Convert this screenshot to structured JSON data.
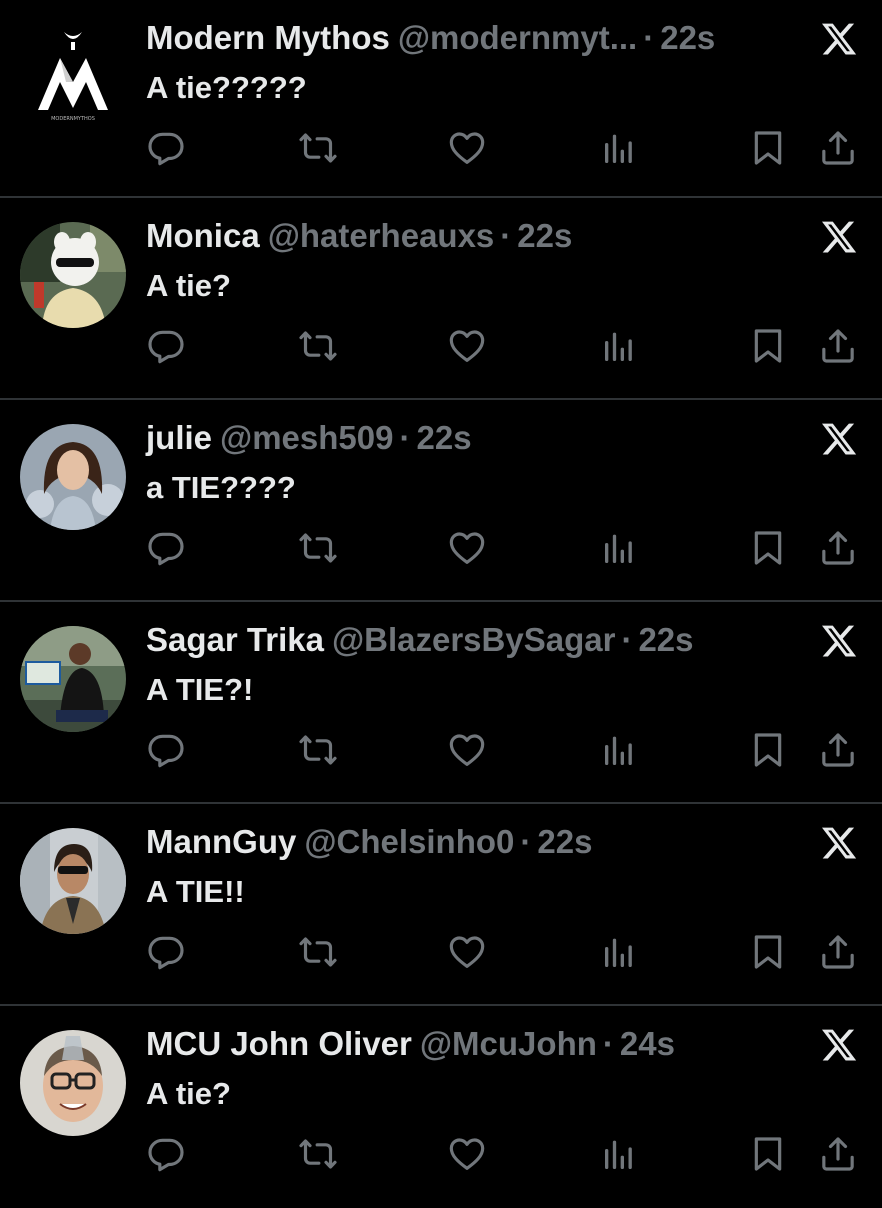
{
  "tweets": [
    {
      "name": "Modern Mythos",
      "handle": "@modernmyt...",
      "time": "22s",
      "text": "A tie?????",
      "avatar": "modern-mythos-logo",
      "avatar_text": "MODERNMYTHOS"
    },
    {
      "name": "Monica",
      "handle": "@haterheauxs",
      "time": "22s",
      "text": "A tie?",
      "avatar": "character-in-sunglasses"
    },
    {
      "name": "julie",
      "handle": "@mesh509",
      "time": "22s",
      "text": "a TIE????",
      "avatar": "woman-portrait"
    },
    {
      "name": "Sagar Trika",
      "handle": "@BlazersBySagar",
      "time": "22s",
      "text": "A TIE?!",
      "avatar": "man-in-stadium"
    },
    {
      "name": "MannGuy",
      "handle": "@Chelsinho0",
      "time": "22s",
      "text": "A TIE!!",
      "avatar": "man-in-sunglasses"
    },
    {
      "name": "MCU John Oliver",
      "handle": "@McuJohn",
      "time": "24s",
      "text": "A tie?",
      "avatar": "john-oliver-portrait"
    }
  ],
  "separator": "·",
  "icons": {
    "reply": "reply-icon",
    "retweet": "retweet-icon",
    "like": "heart-icon",
    "views": "views-icon",
    "bookmark": "bookmark-icon",
    "share": "share-icon",
    "platform": "x-logo-icon"
  },
  "colors": {
    "background": "#000000",
    "text": "#e7e9ea",
    "muted": "#71767b",
    "divider": "#2f3336"
  }
}
